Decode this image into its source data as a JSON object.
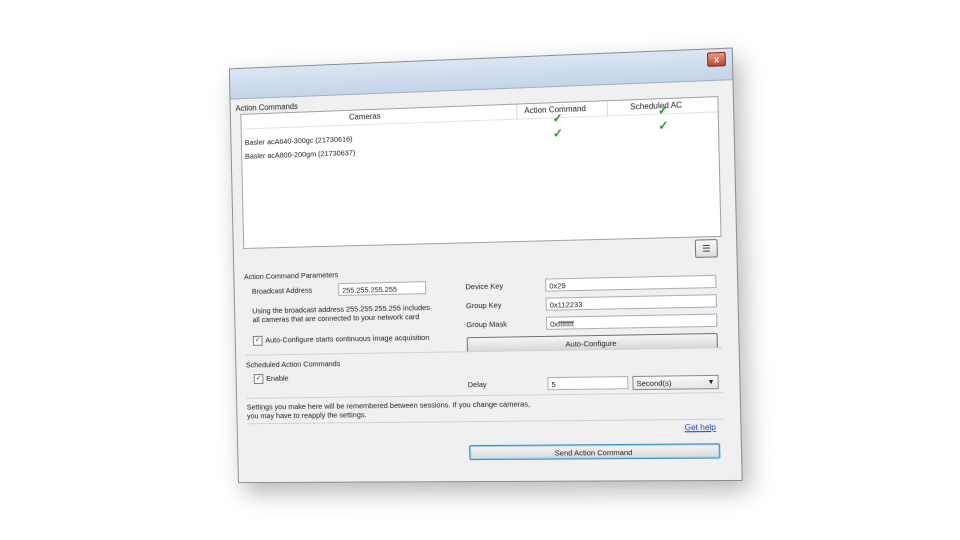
{
  "window": {
    "title": "Action Commands",
    "close_glyph": "x"
  },
  "cameras_list": {
    "columns": [
      "Cameras",
      "Action Command",
      "Scheduled AC"
    ],
    "rows": [
      {
        "name": "Basler acA640-300gc (21730616)",
        "action_command": true,
        "scheduled_ac": true
      },
      {
        "name": "Basler acA800-200gm (21730637)",
        "action_command": true,
        "scheduled_ac": true
      }
    ],
    "check_glyph": "✓"
  },
  "list_tool_icon": "list-settings-icon",
  "params": {
    "section_title": "Action Command Parameters",
    "broadcast_label": "Broadcast Address",
    "broadcast_value": "255.255.255.255",
    "broadcast_note_1": "Using the broadcast address 255.255.255.255 includes",
    "broadcast_note_2": "all cameras that are connected to your network card",
    "device_key_label": "Device Key",
    "device_key_value": "0x29",
    "group_key_label": "Group Key",
    "group_key_value": "0x112233",
    "group_mask_label": "Group Mask",
    "group_mask_value": "0xffffffff",
    "autoconfig_check_label": "Auto-Configure starts continuous image acquisition",
    "autoconfig_checked": true,
    "autoconfig_button": "Auto-Configure"
  },
  "scheduled": {
    "section_title": "Scheduled Action Commands",
    "enable_label": "Enable",
    "enable_checked": true,
    "delay_label": "Delay",
    "delay_value": "5",
    "unit_value": "Second(s)"
  },
  "footer": {
    "note_1": "Settings you make here will be remembered between sessions. If you change cameras,",
    "note_2": "you may have to reapply the settings.",
    "help_link": "Get help",
    "send_button": "Send Action Command"
  },
  "colors": {
    "check": "#1f9a1f",
    "link": "#1a3fd0",
    "primary_border": "#3a8fc8"
  }
}
